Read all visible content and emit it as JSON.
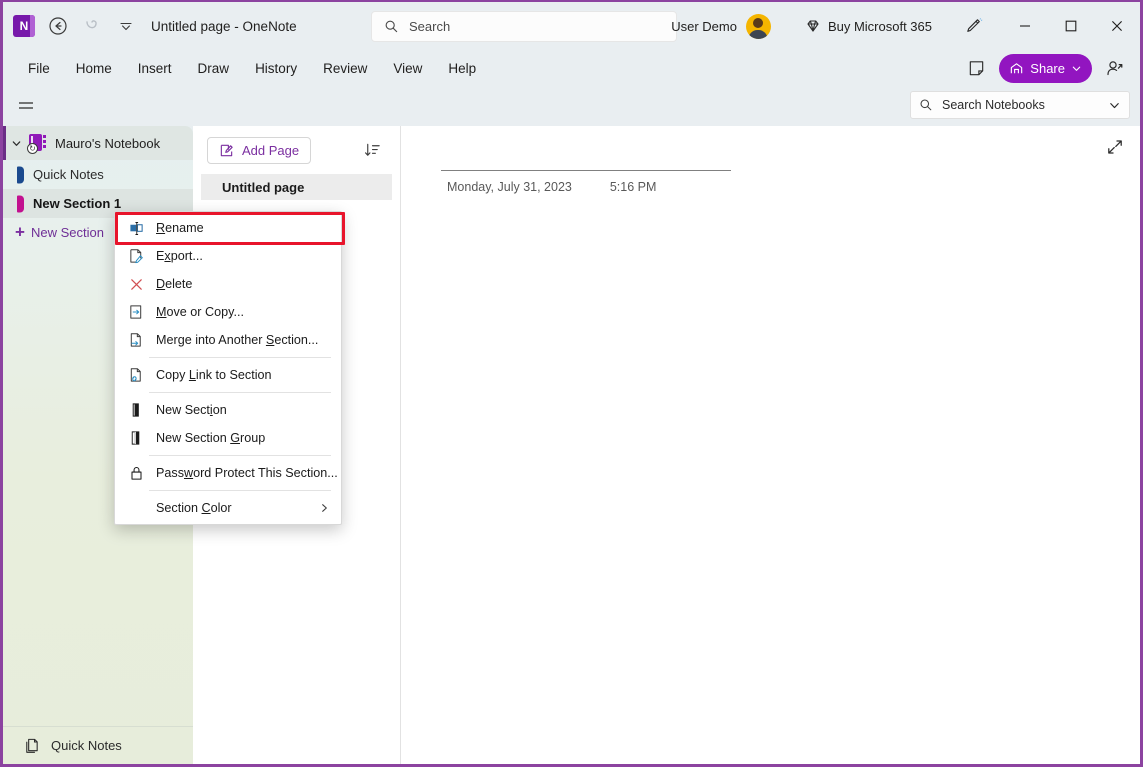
{
  "window": {
    "title": "Untitled page  -  OneNote",
    "logo_letter": "N",
    "accent_color": "#7719aa",
    "border_color": "#8c43a0"
  },
  "titlebar": {
    "back_icon": "back-arrow-icon",
    "undo_icon": "undo-icon",
    "customize_icon": "chevron-down-icon",
    "search": {
      "placeholder": "Search",
      "icon": "search-icon"
    },
    "user_name": "User Demo",
    "buy_label": "Buy Microsoft 365",
    "buy_icon": "diamond-icon",
    "pen_icon": "pen-icon",
    "minimize_label": "Minimize",
    "maximize_label": "Maximize",
    "close_label": "Close"
  },
  "ribbon": {
    "tabs": [
      {
        "label": "File"
      },
      {
        "label": "Home"
      },
      {
        "label": "Insert"
      },
      {
        "label": "Draw"
      },
      {
        "label": "History"
      },
      {
        "label": "Review"
      },
      {
        "label": "View"
      },
      {
        "label": "Help"
      }
    ],
    "sticky_notes_icon": "sticky-note-icon",
    "share_label": "Share",
    "share_color": "#9215c0",
    "share_icon": "share-icon",
    "share_chevron": "chevron-down-icon",
    "add_person_icon": "add-person-icon"
  },
  "row2": {
    "hamburger_icon": "hamburger-menu-icon",
    "notebook_search": {
      "placeholder": "Search Notebooks",
      "icon": "search-icon",
      "chevron": "chevron-down-icon"
    }
  },
  "leftnav": {
    "notebook": {
      "name": "Mauro's Notebook",
      "expand_chevron": "chevron-down-icon",
      "sync_icon": "sync-icon"
    },
    "sections": [
      {
        "label": "Quick Notes",
        "color": "#1a4a8e",
        "selected": false
      },
      {
        "label": "New Section 1",
        "color": "#c2118f",
        "selected": true
      }
    ],
    "new_section_label": "New Section",
    "new_section_icon": "plus-icon",
    "quick_notes_footer": {
      "label": "Quick Notes",
      "icon": "page-copy-icon"
    }
  },
  "pagelist": {
    "add_page_label": "Add Page",
    "add_page_icon": "edit-page-icon",
    "sort_icon": "sort-icon",
    "pages": [
      {
        "label": "Untitled page",
        "selected": true
      }
    ]
  },
  "content": {
    "expand_icon": "expand-diagonal-icon",
    "page_title": "",
    "date": "Monday, July 31, 2023",
    "time": "5:16 PM"
  },
  "context_menu": {
    "highlight_color": "#e8142b",
    "highlighted_item": "Rename",
    "items": [
      {
        "label": "Rename",
        "accel": "R",
        "icon": "rename-icon",
        "sep_after": false,
        "submenu": false
      },
      {
        "label": "Export...",
        "accel": "x",
        "icon": "export-icon",
        "sep_after": false,
        "submenu": false
      },
      {
        "label": "Delete",
        "accel": "D",
        "icon": "delete-x-icon",
        "sep_after": false,
        "submenu": false
      },
      {
        "label": "Move or Copy...",
        "accel": "M",
        "icon": "move-copy-icon",
        "sep_after": false,
        "submenu": false
      },
      {
        "label": "Merge into Another Section...",
        "accel": "S",
        "icon": "merge-icon",
        "sep_after": true,
        "submenu": false
      },
      {
        "label": "Copy Link to Section",
        "accel": "L",
        "icon": "copy-link-icon",
        "sep_after": true,
        "submenu": false
      },
      {
        "label": "New Section",
        "accel": "i",
        "icon": "new-section-icon",
        "sep_after": false,
        "submenu": false
      },
      {
        "label": "New Section Group",
        "accel": "G",
        "icon": "new-section-group-icon",
        "sep_after": true,
        "submenu": false
      },
      {
        "label": "Password Protect This Section...",
        "accel": "w",
        "icon": "lock-icon",
        "sep_after": true,
        "submenu": false
      },
      {
        "label": "Section Color",
        "accel": "C",
        "icon": "",
        "sep_after": false,
        "submenu": true
      }
    ]
  }
}
